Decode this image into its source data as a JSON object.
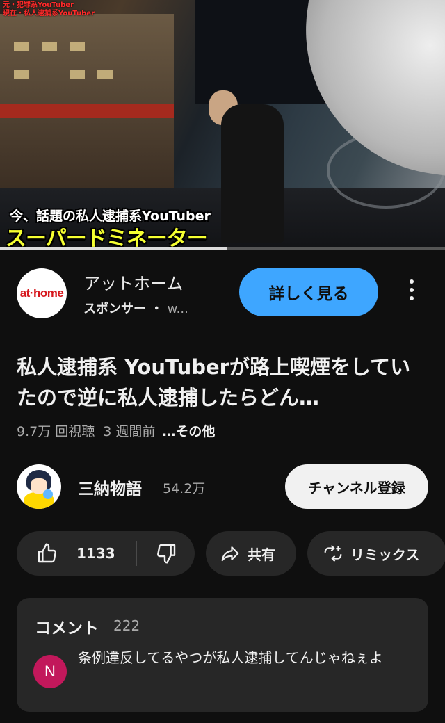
{
  "video": {
    "top_caption": "元・犯罪系YouTuber\n現在・私人逮捕系YouTuber",
    "caption_line1": "今、話題の私人逮捕系YouTuber",
    "caption_line2": "スーパードミネーター",
    "progress_fraction": 0.51
  },
  "ad": {
    "logo_text": "at·home",
    "title": "アットホーム",
    "sponsor_label": "スポンサー",
    "separator": "・",
    "domain": "w...",
    "cta_label": "詳しく見る"
  },
  "video_info": {
    "title": "私人逮捕系 YouTuberが路上喫煙をしていたので逆に私人逮捕したらどん…",
    "views": "9.7万 回視聴",
    "age": "3 週間前",
    "more_label": "…その他"
  },
  "channel": {
    "name": "三納物語",
    "subscribers": "54.2万",
    "subscribe_label": "チャンネル登録"
  },
  "actions": {
    "like_count": "1133",
    "share_label": "共有",
    "remix_label": "リミックス"
  },
  "comments": {
    "heading": "コメント",
    "count": "222",
    "top_comment": {
      "avatar_letter": "N",
      "avatar_color": "#c2185b",
      "text": "条例違反してるやつが私人逮捕してんじゃねぇよ"
    }
  },
  "colors": {
    "background": "#0f0f0f",
    "accent_button": "#3ea6ff",
    "chip": "#272727"
  }
}
